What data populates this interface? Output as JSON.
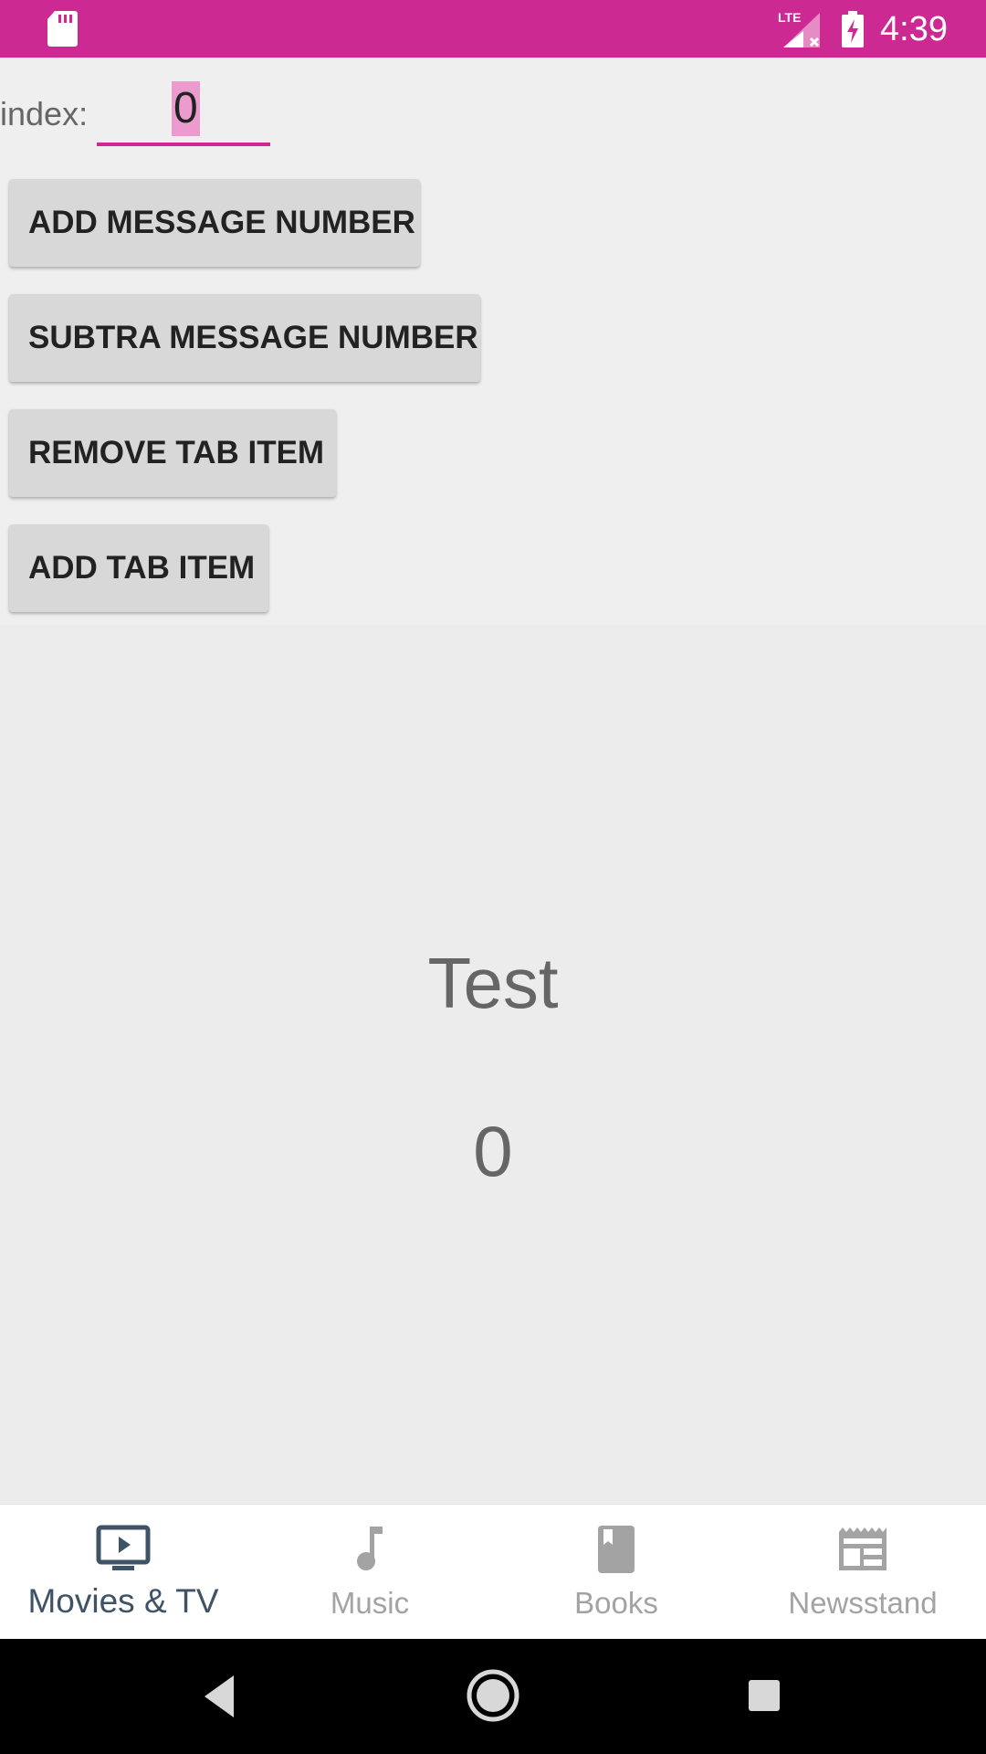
{
  "status_bar": {
    "time": "4:39",
    "network": "LTE",
    "icons": [
      "sd-card-icon",
      "lte-signal-icon",
      "battery-charging-icon"
    ],
    "color": "#cc2a92"
  },
  "index_input": {
    "label": "index:",
    "value": "0"
  },
  "buttons": [
    {
      "label": "ADD MESSAGE NUMBER"
    },
    {
      "label": "SUBTRA MESSAGE NUMBER"
    },
    {
      "label": "REMOVE TAB ITEM"
    },
    {
      "label": "ADD TAB ITEM"
    }
  ],
  "content": {
    "title": "Test",
    "count": "0"
  },
  "bottom_nav": {
    "active_color": "#3f5366",
    "inactive_color": "#a3a3a3",
    "tabs": [
      {
        "label": "Movies & TV",
        "icon": "tv-play-icon",
        "active": true
      },
      {
        "label": "Music",
        "icon": "music-note-icon",
        "active": false
      },
      {
        "label": "Books",
        "icon": "book-icon",
        "active": false
      },
      {
        "label": "Newsstand",
        "icon": "newspaper-icon",
        "active": false
      }
    ]
  },
  "system_nav": {
    "icons": [
      "back-icon",
      "home-icon",
      "recents-icon"
    ]
  }
}
